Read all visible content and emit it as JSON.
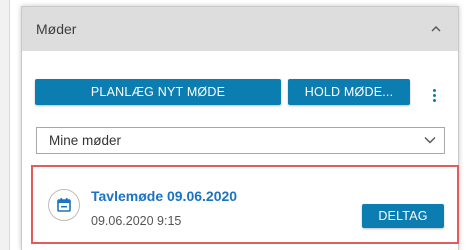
{
  "panel": {
    "title": "Møder",
    "collapse_icon": "chevron-up-icon"
  },
  "actions": {
    "plan_label": "PLANLÆG NYT MØDE",
    "hold_label": "HOLD MØDE...",
    "more_icon": "kebab-menu-icon"
  },
  "filter": {
    "selected": "Mine møder",
    "arrow_icon": "chevron-down-icon"
  },
  "meeting": {
    "title": "Tavlemøde 09.06.2020",
    "datetime": "09.06.2020 9:15",
    "join_label": "DELTAG",
    "icon": "calendar-icon"
  },
  "colors": {
    "primary": "#0b7db0",
    "link": "#1b73c4",
    "header_bg": "#dddddd",
    "highlight": "#e45b5b"
  }
}
